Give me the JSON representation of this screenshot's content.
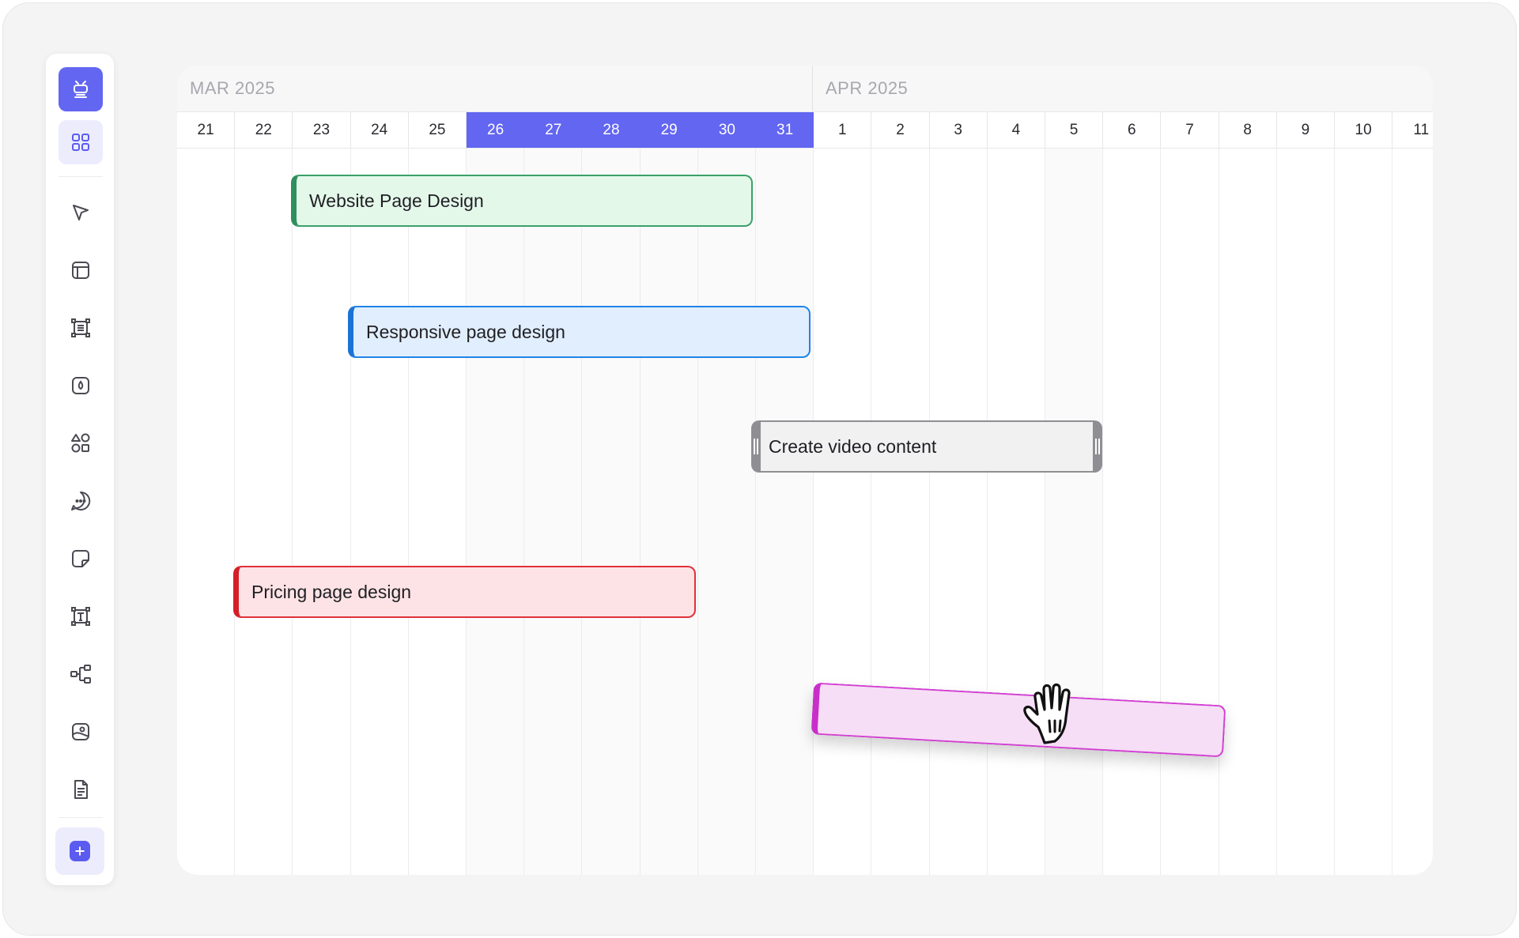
{
  "toolbar": {
    "items": [
      {
        "name": "robot-icon",
        "active": "main"
      },
      {
        "name": "grid-icon",
        "active": "sub"
      },
      {
        "name": "cursor-icon"
      },
      {
        "name": "layout-icon"
      },
      {
        "name": "frame-icon"
      },
      {
        "name": "ink-icon"
      },
      {
        "name": "shapes-icon"
      },
      {
        "name": "comment-icon"
      },
      {
        "name": "sticky-note-icon"
      },
      {
        "name": "text-icon"
      },
      {
        "name": "mindmap-icon"
      },
      {
        "name": "embed-icon"
      },
      {
        "name": "document-icon"
      }
    ],
    "add_icon": "plus-icon"
  },
  "gantt": {
    "months": [
      {
        "label": "MAR 2025"
      },
      {
        "label": "APR 2025"
      }
    ],
    "days": [
      "21",
      "22",
      "23",
      "24",
      "25",
      "26",
      "27",
      "28",
      "29",
      "30",
      "31",
      "1",
      "2",
      "3",
      "4",
      "5",
      "6",
      "7",
      "8",
      "9",
      "10",
      "11"
    ],
    "selected_days": [
      "26",
      "27",
      "28",
      "29",
      "30",
      "31"
    ],
    "tasks": [
      {
        "label": "Website Page Design",
        "color": "#2f8f5c"
      },
      {
        "label": "Responsive page design",
        "color": "#1a73d6"
      },
      {
        "label": "Create video content",
        "color": "#8e8e93"
      },
      {
        "label": "Pricing page design",
        "color": "#d51f28"
      },
      {
        "label": "",
        "color": "#c92ec9"
      }
    ]
  },
  "colors": {
    "accent": "#6366f1",
    "accent_light": "#ececfd"
  }
}
